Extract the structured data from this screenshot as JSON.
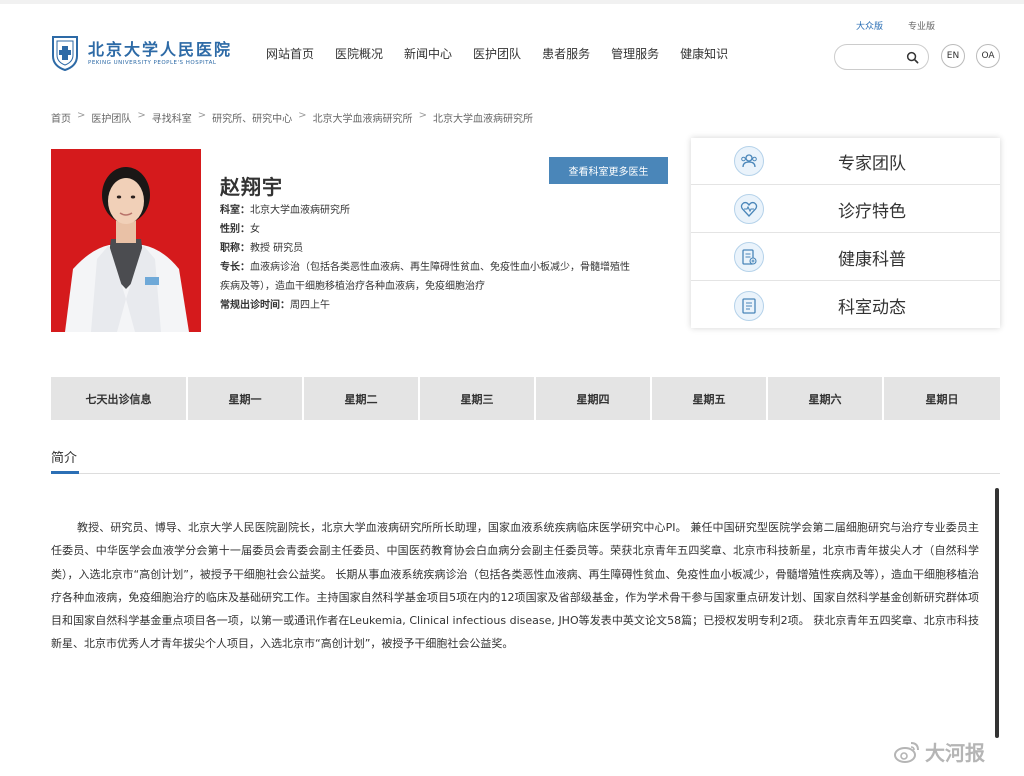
{
  "header": {
    "version_links": [
      "大众版",
      "专业版"
    ],
    "logo": {
      "cn": "北京大学人民医院",
      "en": "PEKING UNIVERSITY PEOPLE'S HOSPITAL"
    },
    "nav": [
      "网站首页",
      "医院概况",
      "新闻中心",
      "医护团队",
      "患者服务",
      "管理服务",
      "健康知识"
    ],
    "search": {
      "placeholder": ""
    },
    "lang_button": "EN",
    "oa_button": "OA"
  },
  "breadcrumb": [
    "首页",
    "医护团队",
    "寻找科室",
    "研究所、研究中心",
    "北京大学血液病研究所",
    "北京大学血液病研究所"
  ],
  "doctor": {
    "name": "赵翔宇",
    "more_button": "查看科室更多医生",
    "dept_label": "科室：",
    "dept": "北京大学血液病研究所",
    "gender_label": "性别：",
    "gender": "女",
    "title_label": "职称：",
    "title": "教授 研究员",
    "specialty_label": "专长：",
    "specialty_line1": "血液病诊治（包括各类恶性血液病、再生障碍性贫血、免疫性血小板减少，骨髓增殖性",
    "specialty_line2": "疾病及等），造血干细胞移植治疗各种血液病，免疫细胞治疗",
    "clinic_label": "常规出诊时间：",
    "clinic": "周四上午"
  },
  "side_panel": [
    "专家团队",
    "诊疗特色",
    "健康科普",
    "科室动态"
  ],
  "schedule": [
    "七天出诊信息",
    "星期一",
    "星期二",
    "星期三",
    "星期四",
    "星期五",
    "星期六",
    "星期日"
  ],
  "intro": {
    "tab": "简介",
    "bio": "教授、研究员、博导、北京大学人民医院副院长，北京大学血液病研究所所长助理，国家血液系统疾病临床医学研究中心PI。 兼任中国研究型医院学会第二届细胞研究与治疗专业委员主任委员、中华医学会血液学分会第十一届委员会青委会副主任委员、中国医药教育协会白血病分会副主任委员等。荣获北京青年五四奖章、北京市科技新星，北京市青年拔尖人才（自然科学类），入选北京市“高创计划”，被授予干细胞社会公益奖。 长期从事血液系统疾病诊治（包括各类恶性血液病、再生障碍性贫血、免疫性血小板减少，骨髓增殖性疾病及等），造血干细胞移植治疗各种血液病，免疫细胞治疗的临床及基础研究工作。主持国家自然科学基金项目5项在内的12项国家及省部级基金，作为学术骨干参与国家重点研发计划、国家自然科学基金创新研究群体项目和国家自然科学基金重点项目各一项，以第一或通讯作者在Leukemia, Clinical infectious disease, JHO等发表中英文论文58篇；已授权发明专利2项。 获北京青年五四奖章、北京市科技新星、北京市优秀人才青年拔尖个人项目，入选北京市“高创计划”，被授予干细胞社会公益奖。"
  },
  "watermark": "大河报",
  "colors": {
    "accent": "#2b6fb5",
    "button": "#4a86b9",
    "photo_bg": "#d51a1c",
    "schedule_bg": "#e4e4e4"
  }
}
